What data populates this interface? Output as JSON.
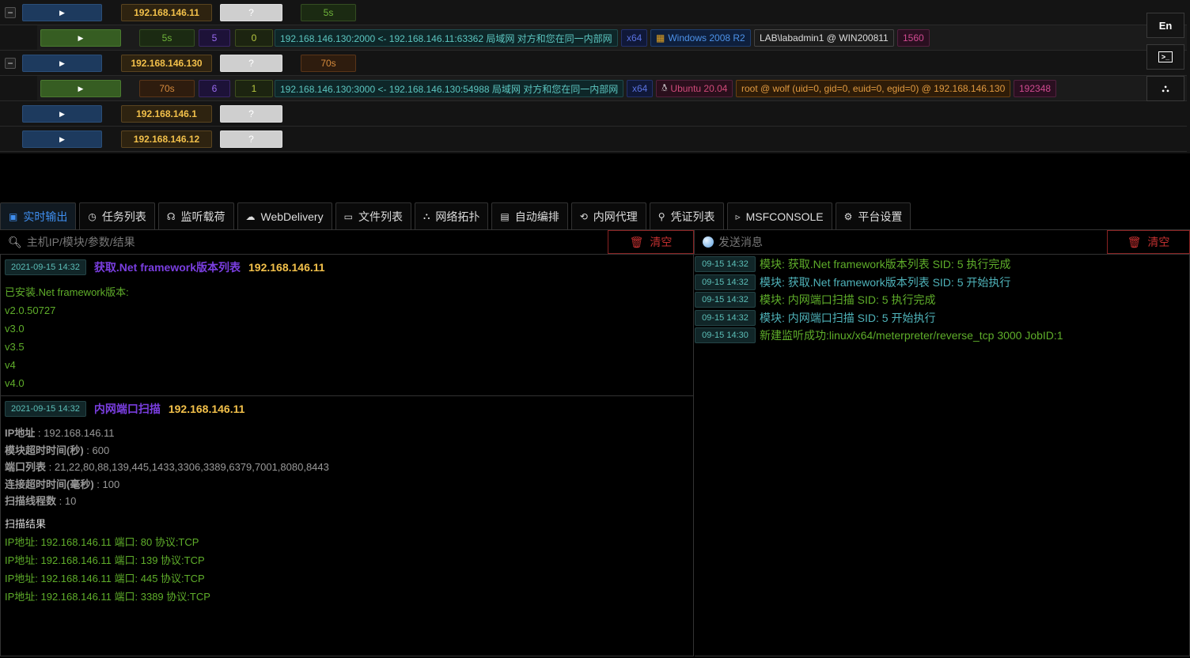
{
  "hosts": [
    {
      "ip": "192.168.146.11",
      "os": "?",
      "time": "5s",
      "time_color": "green",
      "expanded": true,
      "session": {
        "time": "5s",
        "time_color": "green",
        "sid": "5",
        "job": "0",
        "conn": "192.168.146.130:2000 <- 192.168.146.11:63362 局域网 对方和您在同一内部网",
        "arch": "x64",
        "os_icon": "windows-icon",
        "os": "Windows 2008 R2",
        "user": "LAB\\labadmin1 @ WIN200811",
        "pid": "1560"
      }
    },
    {
      "ip": "192.168.146.130",
      "os": "?",
      "time": "70s",
      "time_color": "orange",
      "expanded": true,
      "session": {
        "time": "70s",
        "time_color": "orange",
        "sid": "6",
        "job": "1",
        "conn": "192.168.146.130:3000 <- 192.168.146.130:54988 局域网 对方和您在同一内部网",
        "arch": "x64",
        "os_icon": "linux-icon",
        "os": "Ubuntu 20.04",
        "user": "root @ wolf (uid=0, gid=0, euid=0, egid=0) @ 192.168.146.130",
        "pid": "192348"
      }
    },
    {
      "ip": "192.168.146.1",
      "os": "?"
    },
    {
      "ip": "192.168.146.12",
      "os": "?"
    }
  ],
  "side_buttons": {
    "lang": "En"
  },
  "tabs": [
    {
      "label": "实时输出",
      "icon": "monitor-icon",
      "active": true
    },
    {
      "label": "任务列表",
      "icon": "clock-icon"
    },
    {
      "label": "监听载荷",
      "icon": "headphones-icon"
    },
    {
      "label": "WebDelivery",
      "icon": "cloud-icon"
    },
    {
      "label": "文件列表",
      "icon": "folder-icon"
    },
    {
      "label": "网络拓扑",
      "icon": "network-icon"
    },
    {
      "label": "自动编排",
      "icon": "robot-icon"
    },
    {
      "label": "内网代理",
      "icon": "proxy-icon"
    },
    {
      "label": "凭证列表",
      "icon": "key-icon"
    },
    {
      "label": "MSFCONSOLE",
      "icon": "terminal-icon"
    },
    {
      "label": "平台设置",
      "icon": "gear-icon"
    }
  ],
  "left": {
    "search_placeholder": "主机IP/模块/参数/结果",
    "clear_label": "清空"
  },
  "right": {
    "message_placeholder": "发送消息",
    "clear_label": "清空"
  },
  "results": [
    {
      "time": "2021-09-15 14:32",
      "module": "获取.Net framework版本列表",
      "ip": "192.168.146.11",
      "lines": [
        "已安装.Net framework版本:",
        "v2.0.50727",
        "v3.0",
        "v3.5",
        "v4",
        "v4.0"
      ]
    },
    {
      "time": "2021-09-15 14:32",
      "module": "内网端口扫描",
      "ip": "192.168.146.11",
      "params": [
        [
          "IP地址",
          "192.168.146.11"
        ],
        [
          "模块超时时间(秒)",
          "600"
        ],
        [
          "端口列表",
          "21,22,80,88,139,445,1433,3306,3389,6379,7001,8080,8443"
        ],
        [
          "连接超时时间(毫秒)",
          "100"
        ],
        [
          "扫描线程数",
          "10"
        ]
      ],
      "result_title": "扫描结果",
      "lines": [
        "IP地址: 192.168.146.11 端口: 80 协议:TCP",
        "IP地址: 192.168.146.11 端口: 139 协议:TCP",
        "IP地址: 192.168.146.11 端口: 445 协议:TCP",
        "IP地址: 192.168.146.11 端口: 3389 协议:TCP"
      ]
    }
  ],
  "messages": [
    {
      "time": "09-15 14:32",
      "text": "模块: 获取.Net framework版本列表 SID: 5 执行完成",
      "color": "green"
    },
    {
      "time": "09-15 14:32",
      "text": "模块: 获取.Net framework版本列表 SID: 5 开始执行",
      "color": "cyan"
    },
    {
      "time": "09-15 14:32",
      "text": "模块: 内网端口扫描 SID: 5 执行完成",
      "color": "green"
    },
    {
      "time": "09-15 14:32",
      "text": "模块: 内网端口扫描 SID: 5 开始执行",
      "color": "cyan"
    },
    {
      "time": "09-15 14:30",
      "text": "新建监听成功:linux/x64/meterpreter/reverse_tcp 3000 JobID:1",
      "color": "green"
    }
  ]
}
